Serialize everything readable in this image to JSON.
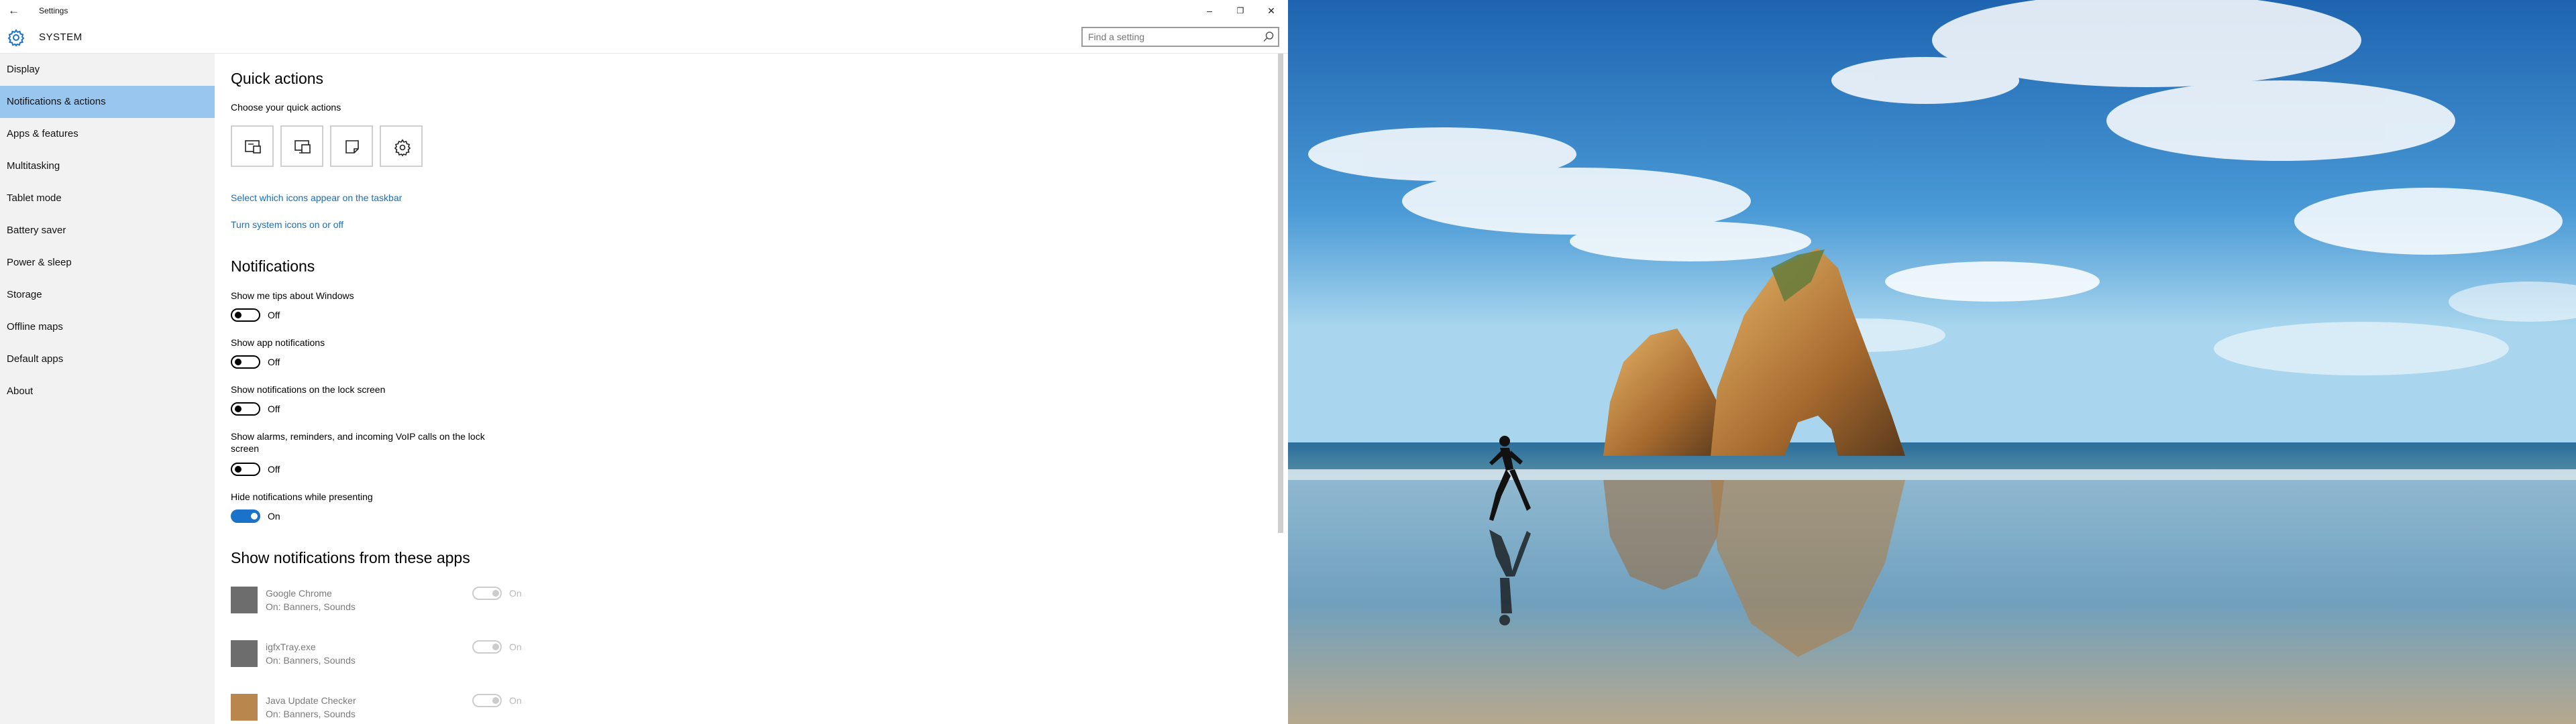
{
  "window": {
    "title": "Settings",
    "section": "SYSTEM",
    "search_placeholder": "Find a setting",
    "controls": {
      "minimize": "–",
      "restore": "❐",
      "close": "✕"
    },
    "back_glyph": "←"
  },
  "sidebar": {
    "items": [
      {
        "label": "Display"
      },
      {
        "label": "Notifications & actions",
        "active": true
      },
      {
        "label": "Apps & features"
      },
      {
        "label": "Multitasking"
      },
      {
        "label": "Tablet mode"
      },
      {
        "label": "Battery saver"
      },
      {
        "label": "Power & sleep"
      },
      {
        "label": "Storage"
      },
      {
        "label": "Offline maps"
      },
      {
        "label": "Default apps"
      },
      {
        "label": "About"
      }
    ]
  },
  "quick_actions": {
    "heading": "Quick actions",
    "subheading": "Choose your quick actions",
    "buttons": [
      {
        "icon": "action-center-icon"
      },
      {
        "icon": "project-icon"
      },
      {
        "icon": "note-icon"
      },
      {
        "icon": "settings-icon"
      }
    ],
    "link_taskbar": "Select which icons appear on the taskbar",
    "link_system_icons": "Turn system icons on or off"
  },
  "notifications": {
    "heading": "Notifications",
    "settings": [
      {
        "label": "Show me tips about Windows",
        "state": "Off"
      },
      {
        "label": "Show app notifications",
        "state": "Off"
      },
      {
        "label": "Show notifications on the lock screen",
        "state": "Off"
      },
      {
        "label_line1": "Show alarms, reminders, and incoming VoIP calls on the lock",
        "label_line2": "screen",
        "state": "Off"
      },
      {
        "label": "Hide notifications while presenting",
        "state": "On"
      }
    ]
  },
  "apps": {
    "heading": "Show notifications from these apps",
    "items": [
      {
        "name": "Google Chrome",
        "detail": "On: Banners, Sounds",
        "state": "On"
      },
      {
        "name": "igfxTray.exe",
        "detail": "On: Banners, Sounds",
        "state": "On"
      },
      {
        "name": "Java Update Checker",
        "detail": "On: Banners, Sounds",
        "state": "On"
      }
    ]
  },
  "colors": {
    "accent": "#1a73c8",
    "selected_nav": "#99c6ef",
    "link": "#1a6fb5",
    "sidebar_bg": "#f2f2f2"
  }
}
